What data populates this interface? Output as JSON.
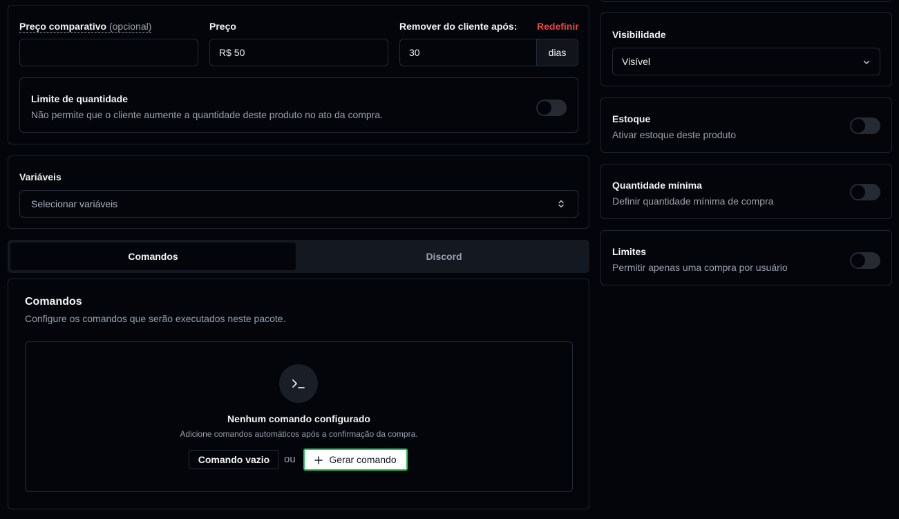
{
  "pricing": {
    "compare_label": "Preço comparativo",
    "compare_optional": "(opcional)",
    "compare_value": "",
    "price_label": "Preço",
    "price_value": "R$ 50",
    "remove_label": "Remover do cliente após:",
    "reset_label": "Redefinir",
    "remove_value": "30",
    "remove_unit": "dias"
  },
  "quantity_limit": {
    "title": "Limite de quantidade",
    "description": "Não permite que o cliente aumente a quantidade deste produto no ato da compra.",
    "enabled": false
  },
  "variables": {
    "label": "Variáveis",
    "placeholder": "Selecionar variáveis"
  },
  "tabs": [
    {
      "label": "Comandos",
      "active": true
    },
    {
      "label": "Discord",
      "active": false
    }
  ],
  "commands": {
    "title": "Comandos",
    "subtitle": "Configure os comandos que serão executados neste pacote.",
    "empty_title": "Nenhum comando configurado",
    "empty_description": "Adicione comandos automáticos após a confirmação da compra.",
    "empty_button_label": "Comando vazio",
    "or_text": "ou",
    "generate_button_label": "Gerar comando",
    "icon": "terminal-icon"
  },
  "sidebar": {
    "visibility": {
      "label": "Visibilidade",
      "value": "Visível"
    },
    "stock": {
      "title": "Estoque",
      "description": "Ativar estoque deste produto",
      "enabled": false
    },
    "min_quantity": {
      "title": "Quantidade mínima",
      "description": "Definir quantidade mínima de compra",
      "enabled": false
    },
    "limits": {
      "title": "Limites",
      "description": "Permitir apenas uma compra por usuário",
      "enabled": false
    }
  },
  "colors": {
    "background": "#03050b",
    "border": "#1f2430",
    "danger": "#ef4444",
    "highlight": "#22c55e",
    "toggle_off": "#262a33"
  }
}
